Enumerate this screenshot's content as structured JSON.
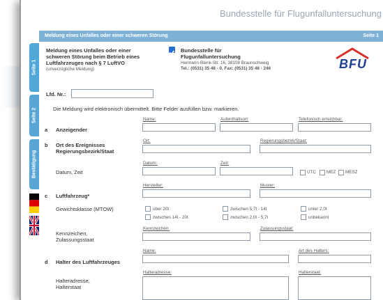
{
  "header": {
    "title": "Bundesstelle für Flugunfalluntersuchung"
  },
  "bar": {
    "left": "Meldung eines Unfalles oder einer schweren Störung",
    "right": "Seite 1"
  },
  "tabs": [
    "Seite 1",
    "Seite 2",
    "Bestätigung"
  ],
  "intro": {
    "title_line1": "Meldung eines Unfalles oder einer",
    "title_line2": "schweren Störung beim Betrieb eines",
    "title_line3": "Luftfahrzeuges nach § 7 LuftVO",
    "subtitle": "(unverzügliche Meldung)",
    "addr_line1": "Bundesstelle für",
    "addr_line2": "Flugunfalluntersuchung",
    "addr_line3": "Hermann-Blenk-Str. 16, 38108 Braunschweig",
    "addr_line4": "Tel.: (0531) 35 48 - 0, Fax: (0531) 35 48 - 246",
    "logo_text": "BFU",
    "lfd_label": "Lfd. Nr.:",
    "note": "Die Meldung wird elektronisch übermittelt. Bitte Felder ausfüllen bzw. markieren."
  },
  "sections": {
    "a": {
      "letter": "a",
      "label": "Anzeigender",
      "f1": "Name:",
      "f2": "Aufenthaltsort:",
      "f3": "Telefonisch erreichbar:"
    },
    "b": {
      "letter": "b",
      "label1": "Ort des Ereignisses",
      "label2": "Regierungsbezirk/Staat",
      "f1": "Ort:",
      "f2": "Regierungsbezirk/Staat:"
    },
    "b2": {
      "label": "Datum, Zeit",
      "f1": "Datum:",
      "f2": "Zeit:",
      "tz": [
        "UTC",
        "MEZ",
        "MESZ"
      ]
    },
    "c": {
      "letter": "c",
      "label": "Luftfahrzeug*",
      "f1": "Hersteller:",
      "f2": "Muster:"
    },
    "mtow": {
      "label": "Gewichtsklasse (MTOW)",
      "opts": [
        "über 20t",
        "zwischen 5,7t - 14t",
        "unter 2,0t",
        "zwischen 14t - 20t",
        "zwischen 2,0t - 5,7t",
        "unbekannt"
      ]
    },
    "kz": {
      "label1": "Kennzeichen,",
      "label2": "Zulassungsstaat",
      "f1": "Kennzeichen:",
      "f2": "Zulassungsstaat:"
    },
    "d": {
      "letter": "d",
      "label": "Halter des Luftfahrzeuges",
      "f1": "Name:",
      "f2": "Art des Halters:"
    },
    "ha": {
      "label1": "Halteradresse,",
      "label2": "Halterstaat",
      "f1": "Halteradresse:",
      "f2": "Halterstaat:"
    }
  },
  "colors": {
    "accent": "#7fb2d9",
    "tab": "#58a6d6",
    "logo_red": "#d9302a",
    "logo_blue": "#1f3f93"
  }
}
